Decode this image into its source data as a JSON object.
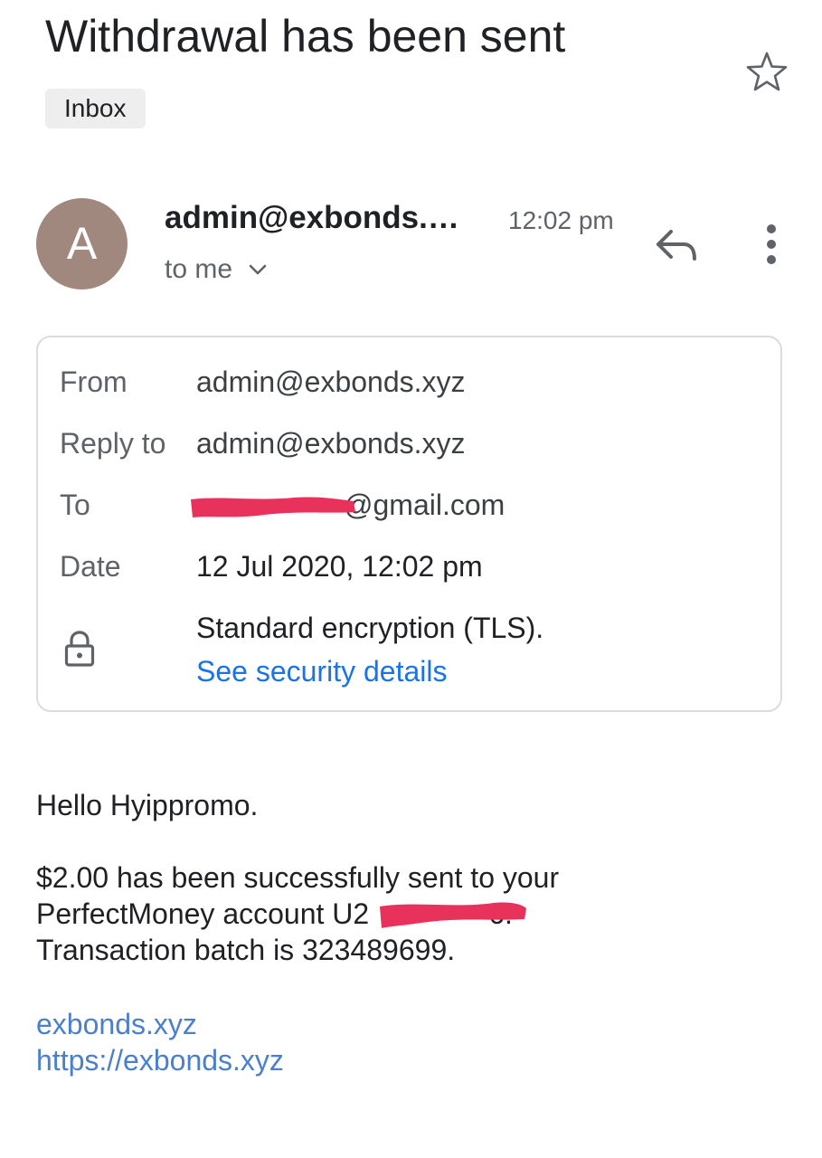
{
  "email": {
    "subject": "Withdrawal has been sent",
    "label": "Inbox",
    "star_icon": "star-outline-icon"
  },
  "sender": {
    "avatar_letter": "A",
    "avatar_color": "#a1887f",
    "name": "admin@exbonds.…",
    "time": "12:02 pm",
    "recipient_summary": "to me",
    "icons": [
      "reply-icon",
      "more-vert-icon",
      "chevron-down-icon"
    ]
  },
  "details": {
    "from_label": "From",
    "from_value": "admin@exbonds.xyz",
    "reply_to_label": "Reply to",
    "reply_to_value": "admin@exbonds.xyz",
    "to_label": "To",
    "to_value": "@gmail.com",
    "date_label": "Date",
    "date_value": "12 Jul 2020, 12:02 pm",
    "encryption": "Standard encryption (TLS).",
    "security_link": "See security details",
    "redaction_color": "#e8315b"
  },
  "body": {
    "greeting": "Hello Hyippromo.",
    "line1": "$2.00 has been successfully sent to your",
    "line2_prefix": "PerfectMoney account U2",
    "line2_suffix": "6.",
    "line3": "Transaction batch is 323489699.",
    "link1": "exbonds.xyz",
    "link2": "https://exbonds.xyz"
  },
  "colors": {
    "link": "#1a73e8",
    "body_link": "#4a7fcf",
    "muted": "#5f6368"
  }
}
